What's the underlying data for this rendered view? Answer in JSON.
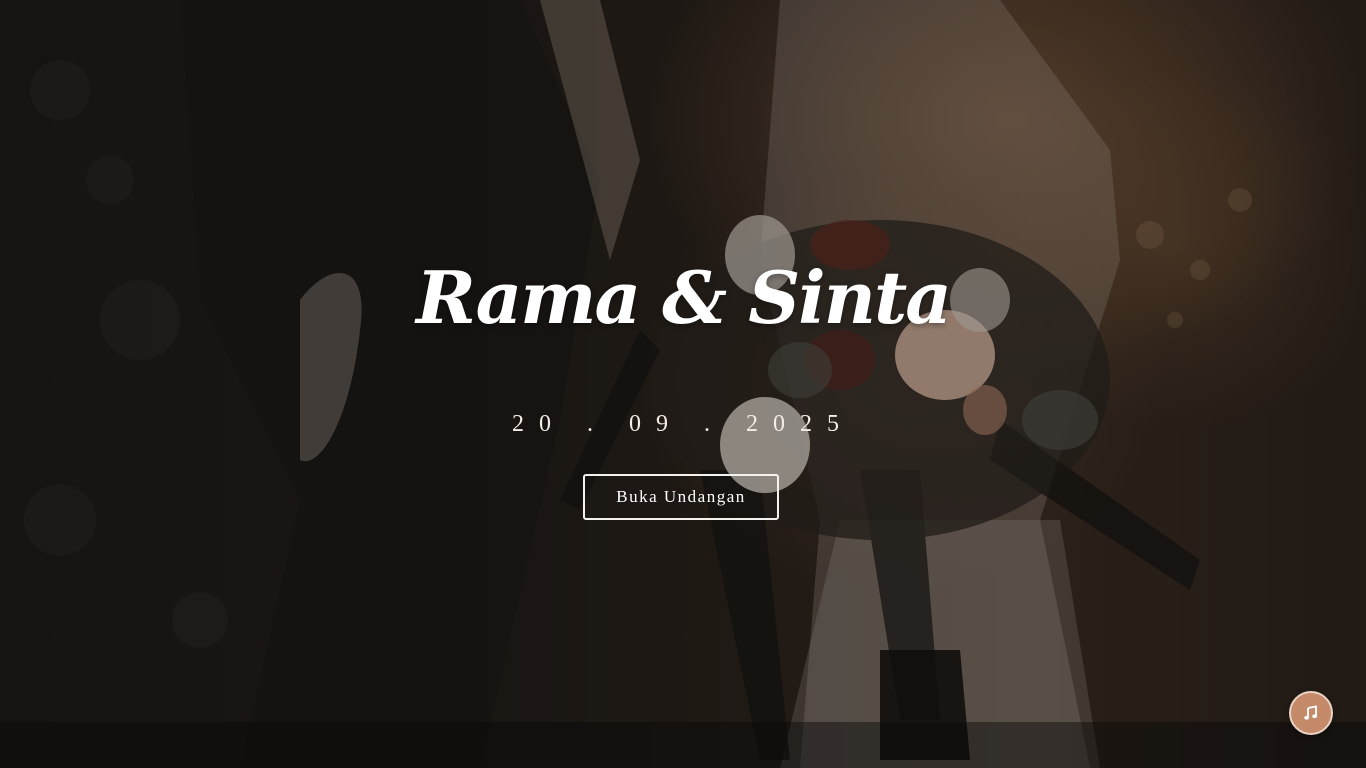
{
  "hero": {
    "couple_name": "Rama & Sinta",
    "date": "20 . 09 . 2025",
    "open_button_label": "Buka Undangan"
  },
  "music": {
    "icon": "music-note-icon"
  },
  "colors": {
    "accent": "#c48a6a",
    "text": "#ffffff",
    "background": "#1b1814"
  }
}
